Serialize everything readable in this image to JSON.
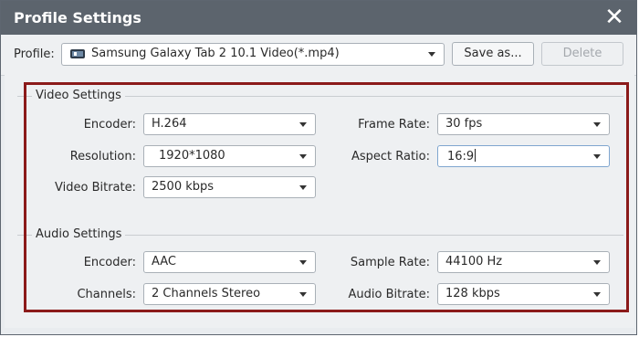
{
  "window": {
    "title": "Profile Settings"
  },
  "profile": {
    "label": "Profile:",
    "value": "Samsung Galaxy Tab 2 10.1 Video(*.mp4)",
    "save_as": "Save as...",
    "delete": "Delete"
  },
  "video": {
    "section_title": "Video Settings",
    "encoder": {
      "label": "Encoder:",
      "value": "H.264"
    },
    "resolution": {
      "label": "Resolution:",
      "value": "1920*1080"
    },
    "bitrate": {
      "label": "Video Bitrate:",
      "value": "2500 kbps"
    },
    "frame_rate": {
      "label": "Frame Rate:",
      "value": "30 fps"
    },
    "aspect_ratio": {
      "label": "Aspect Ratio:",
      "value": "16:9"
    }
  },
  "audio": {
    "section_title": "Audio Settings",
    "encoder": {
      "label": "Encoder:",
      "value": "AAC"
    },
    "channels": {
      "label": "Channels:",
      "value": "2 Channels Stereo"
    },
    "sample_rate": {
      "label": "Sample Rate:",
      "value": "44100 Hz"
    },
    "bitrate": {
      "label": "Audio Bitrate:",
      "value": "128 kbps"
    }
  },
  "icons": {
    "close": "close-icon",
    "device": "tablet-icon",
    "dropdown": "chevron-down-icon"
  },
  "colors": {
    "titlebar": "#5c646d",
    "highlight_border": "#8b1a1a",
    "panel": "#eef0f2"
  }
}
